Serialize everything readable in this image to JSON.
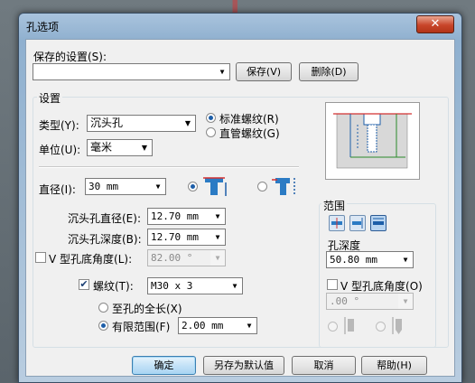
{
  "window": {
    "title": "孔选项",
    "close_glyph": "✕"
  },
  "saved_settings": {
    "label": "保存的设置(S):",
    "value": "",
    "save_button": "保存(V)",
    "delete_button": "删除(D)"
  },
  "settings": {
    "group_title": "设置",
    "type_label": "类型(Y):",
    "type_value": "沉头孔",
    "unit_label": "单位(U):",
    "unit_value": "毫米",
    "thread_standard": "标准螺纹(R)",
    "thread_pipe": "直管螺纹(G)",
    "diameter_label": "直径(I):",
    "diameter_value": "30 mm",
    "cb_diameter_label": "沉头孔直径(E):",
    "cb_diameter_value": "12.70 mm",
    "cb_depth_label": "沉头孔深度(B):",
    "cb_depth_value": "12.70 mm",
    "v_angle_label": "V 型孔底角度(L):",
    "v_angle_value": "82.00 °",
    "thread_label": "螺纹(T):",
    "thread_value": "M30 x 3",
    "full_length_label": "至孔的全长(X)",
    "finite_label": "有限范围(F)",
    "finite_value": "2.00 mm"
  },
  "range": {
    "title": "范围",
    "depth_label": "孔深度",
    "depth_value": "50.80 mm",
    "v_angle_label": "V 型孔底角度(O)",
    "v_angle_value": ".00 °"
  },
  "footer": {
    "ok": "确定",
    "save_default": "另存为默认值",
    "cancel": "取消",
    "help": "帮助(H)"
  },
  "colors": {
    "accent": "#2b7bc4",
    "hole_blue": "#1d5ea8",
    "preview_red": "#d23030",
    "preview_green": "#2a8a2a"
  }
}
